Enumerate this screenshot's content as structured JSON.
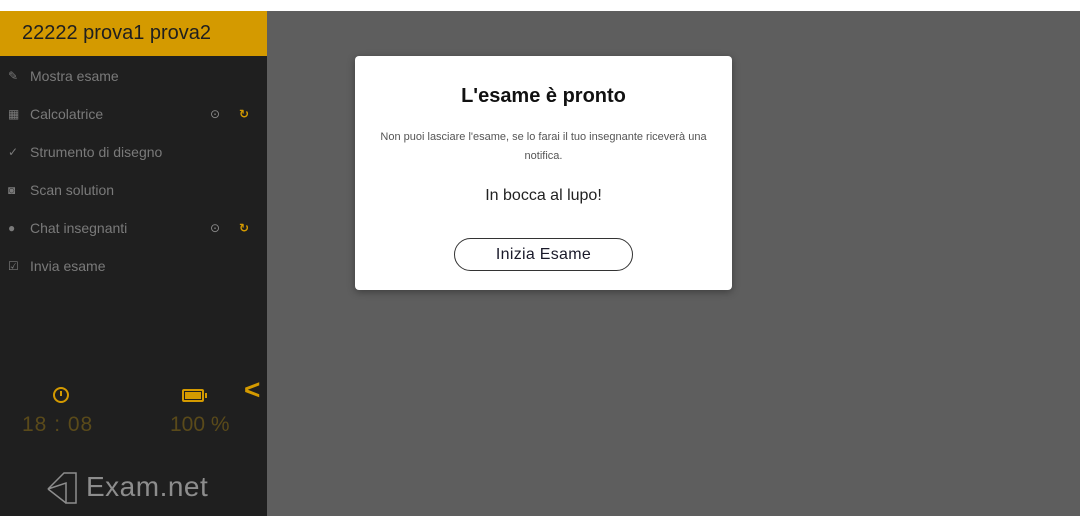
{
  "sidebar": {
    "exam_title": "22222 prova1 prova2",
    "menu": [
      {
        "label": "Mostra esame",
        "icon": "edit-icon",
        "controls": false
      },
      {
        "label": "Calcolatrice",
        "icon": "calculator-icon",
        "controls": true
      },
      {
        "label": "Strumento di disegno",
        "icon": "brush-icon",
        "controls": false
      },
      {
        "label": "Scan solution",
        "icon": "camera-icon",
        "controls": false
      },
      {
        "label": "Chat insegnanti",
        "icon": "chat-icon",
        "controls": true
      },
      {
        "label": "Invia esame",
        "icon": "checkbox-icon",
        "controls": false
      }
    ],
    "clock": "18 : 08",
    "battery": "100 %",
    "logo_text": "Exam.net"
  },
  "modal": {
    "title": "L'esame è pronto",
    "text": "Non puoi lasciare l'esame, se lo farai il tuo insegnante riceverà una notifica.",
    "wish": "In bocca al lupo!",
    "start_label": "Inizia Esame"
  },
  "colors": {
    "accent": "#d49a00",
    "sidebar_bg": "#1f1f1f",
    "main_bg": "#5e5e5e"
  }
}
